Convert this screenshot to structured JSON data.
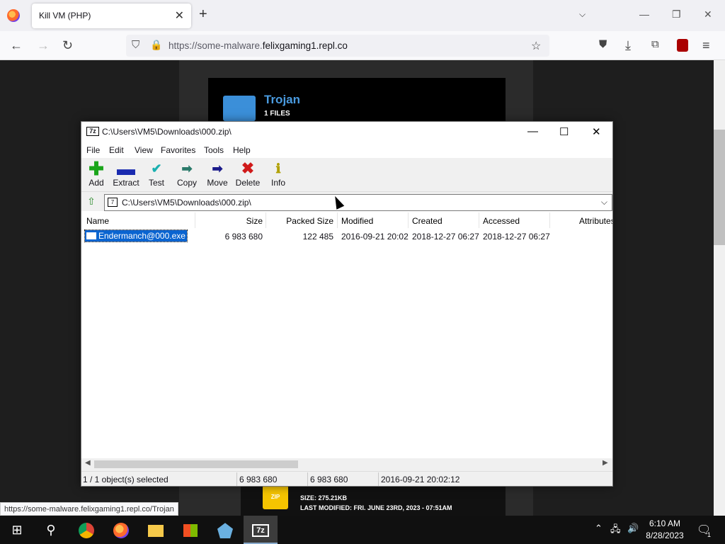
{
  "browser": {
    "tab_title": "Kill VM (PHP)",
    "url_prefix": "https://some-malware.",
    "url_domain": "felixgaming1.repl.co",
    "status_link": "https://some-malware.felixgaming1.repl.co/Trojan"
  },
  "page": {
    "card_title": "Trojan",
    "card_files": "1 FILES",
    "zip_badge": "ZIP",
    "card2_size": "SIZE: 275.21KB",
    "card2_modified": "LAST MODIFIED: FRI. JUNE 23RD, 2023 - 07:51AM"
  },
  "zip": {
    "app_icon": "7z",
    "title": "C:\\Users\\VM5\\Downloads\\000.zip\\",
    "menu": [
      "File",
      "Edit",
      "View",
      "Favorites",
      "Tools",
      "Help"
    ],
    "toolbar": [
      {
        "label": "Add",
        "icon": "plus-icon",
        "color": "#1aa51a"
      },
      {
        "label": "Extract",
        "icon": "minus-icon",
        "color": "#1a2bb0"
      },
      {
        "label": "Test",
        "icon": "check-icon",
        "color": "#1ab0b0"
      },
      {
        "label": "Copy",
        "icon": "copy-arrow-icon",
        "color": "#2a7a6a"
      },
      {
        "label": "Move",
        "icon": "move-arrow-icon",
        "color": "#1a1a8a"
      },
      {
        "label": "Delete",
        "icon": "delete-x-icon",
        "color": "#d01a1a"
      },
      {
        "label": "Info",
        "icon": "info-icon",
        "color": "#b0a000"
      }
    ],
    "address": "C:\\Users\\VM5\\Downloads\\000.zip\\",
    "columns": [
      "Name",
      "Size",
      "Packed Size",
      "Modified",
      "Created",
      "Accessed",
      "Attributes"
    ],
    "row": {
      "name": "Endermanch@000.exe",
      "size": "6 983 680",
      "packed_size": "122 485",
      "modified": "2016-09-21 20:02",
      "created": "2018-12-27 06:27",
      "accessed": "2018-12-27 06:27"
    },
    "status": {
      "selected": "1 / 1 object(s) selected",
      "size": "6 983 680",
      "size2": "6 983 680",
      "modified": "2016-09-21 20:02:12"
    }
  },
  "taskbar": {
    "time": "6:10 AM",
    "date": "8/28/2023",
    "notifications": "1"
  }
}
